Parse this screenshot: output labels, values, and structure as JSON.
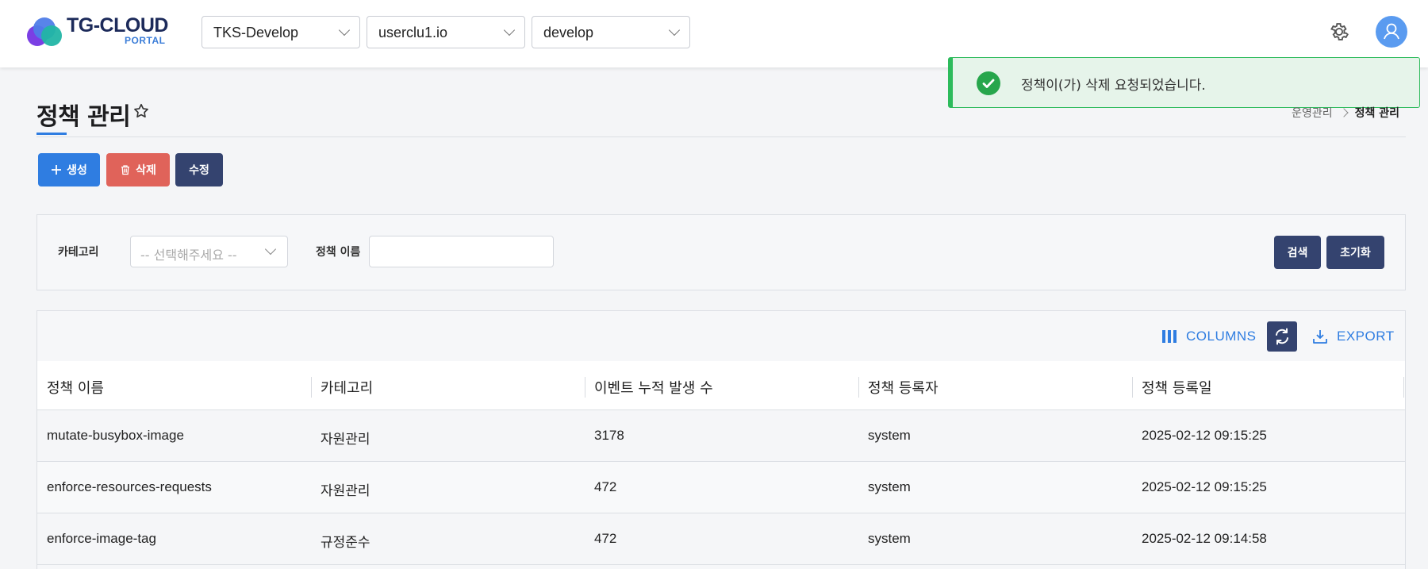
{
  "header": {
    "logo_text": "TG-CLOUD",
    "logo_sub": "PORTAL",
    "selects": [
      "TKS-Develop",
      "userclu1.io",
      "develop"
    ]
  },
  "toast": {
    "message": "정책이(가) 삭제 요청되었습니다."
  },
  "page": {
    "title": "정책 관리",
    "breadcrumb": [
      "운영관리",
      "정책 관리"
    ]
  },
  "actions": {
    "create": "생성",
    "delete": "삭제",
    "edit": "수정"
  },
  "search": {
    "category_label": "카테고리",
    "category_placeholder": "-- 선택해주세요 --",
    "name_label": "정책 이름",
    "name_value": "",
    "search_button": "검색",
    "reset_button": "초기화"
  },
  "toolbar": {
    "columns": "COLUMNS",
    "export": "EXPORT"
  },
  "table": {
    "columns": [
      "정책 이름",
      "카테고리",
      "이벤트 누적 발생 수",
      "정책 등록자",
      "정책 등록일"
    ],
    "rows": [
      [
        "mutate-busybox-image",
        "자원관리",
        "3178",
        "system",
        "2025-02-12 09:15:25"
      ],
      [
        "enforce-resources-requests",
        "자원관리",
        "472",
        "system",
        "2025-02-12 09:15:25"
      ],
      [
        "enforce-image-tag",
        "규정준수",
        "472",
        "system",
        "2025-02-12 09:14:58"
      ]
    ]
  },
  "colors": {
    "primary": "#2f7de1",
    "danger": "#e0635a",
    "navy": "#34436f",
    "success": "#2dbb5c"
  }
}
